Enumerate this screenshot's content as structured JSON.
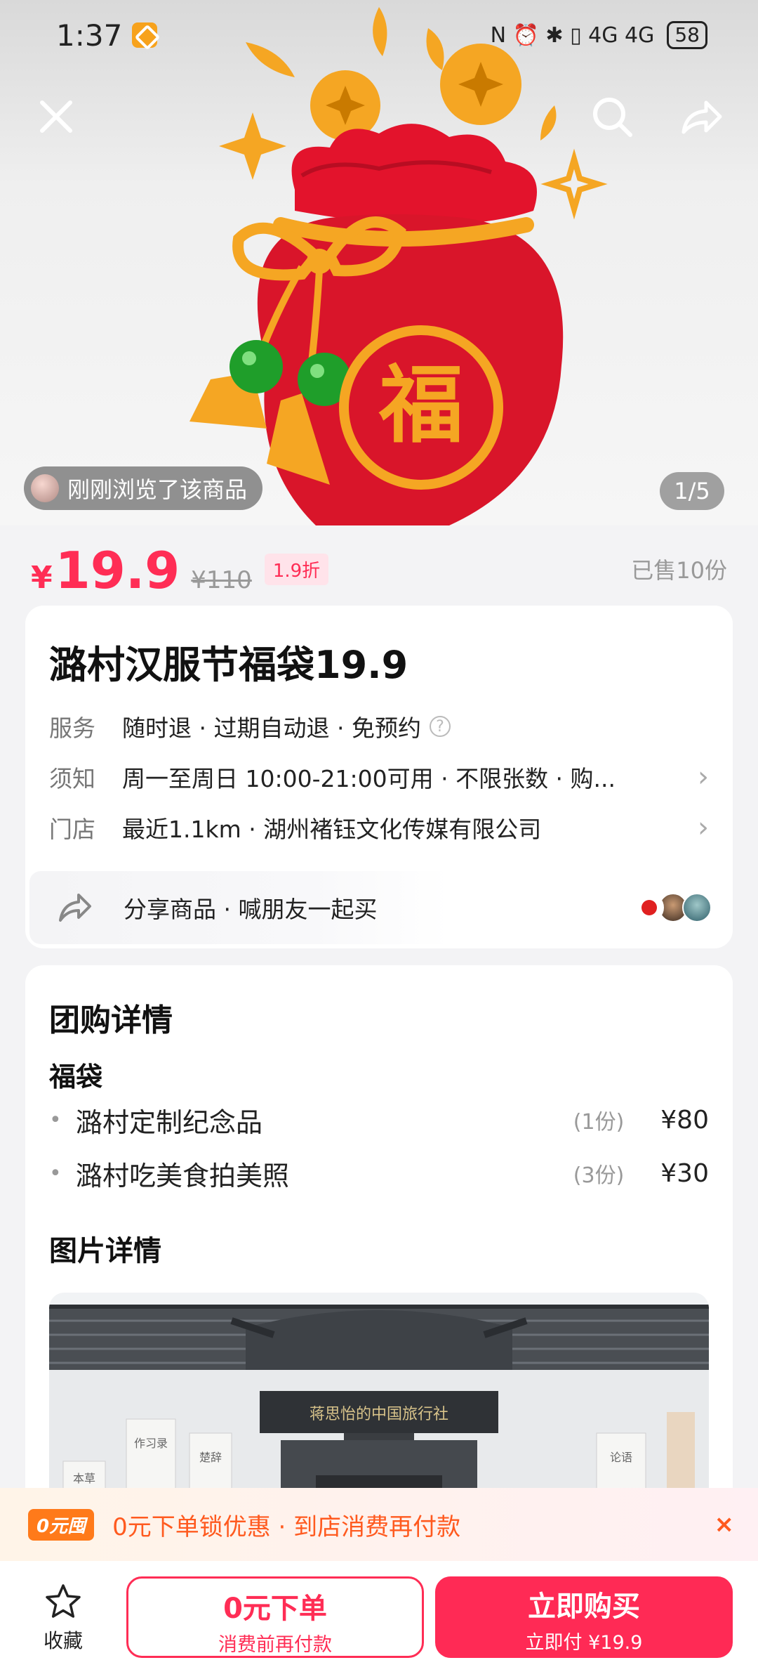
{
  "status": {
    "time": "1:37",
    "icons_text": "N ⏰  ✱ ▯ 4G 4G",
    "battery": "58"
  },
  "hero": {
    "recent_text": "刚刚浏览了该商品",
    "page_indicator": "1/5",
    "image_icon": "lucky-bag-image",
    "bag_char": "福"
  },
  "price": {
    "currency": "¥",
    "value": "19.9",
    "original": "¥110",
    "discount": "1.9折",
    "sold": "已售10份"
  },
  "product": {
    "title": "潞村汉服节福袋19.9",
    "rows": [
      {
        "key": "服务",
        "value": "随时退 · 过期自动退 · 免预约"
      },
      {
        "key": "须知",
        "value": "周一至周日 10:00-21:00可用 · 不限张数 · 购..."
      },
      {
        "key": "门店",
        "value": "最近1.1km · 湖州褚钰文化传媒有限公司"
      }
    ],
    "share_text": "分享商品 · 喊朋友一起买"
  },
  "detail": {
    "title": "团购详情",
    "group_name": "福袋",
    "items": [
      {
        "name": "潞村定制纪念品",
        "qty": "(1份)",
        "price": "¥80"
      },
      {
        "name": "潞村吃美食拍美照",
        "qty": "(3份)",
        "price": "¥30"
      }
    ],
    "photos_title": "图片详情",
    "sign_text": "蒋思怡的中国旅行社",
    "left_board": "作习录",
    "left_board2": "楚辞",
    "right_board": "论语",
    "far_left_board": "本草"
  },
  "promo": {
    "tag": "0元囤",
    "text": "0元下单锁优惠 · 到店消费再付款",
    "close": "×"
  },
  "bottom": {
    "fav_label": "收藏",
    "zero_main": "0元下单",
    "zero_sub": "消费前再付款",
    "buy_main": "立即购买",
    "buy_sub": "立即付 ¥19.9"
  },
  "colors": {
    "accent": "#ff2d55",
    "promo": "#ff5a1f",
    "bag_red": "#d9152a",
    "bag_gold": "#f5a623"
  }
}
